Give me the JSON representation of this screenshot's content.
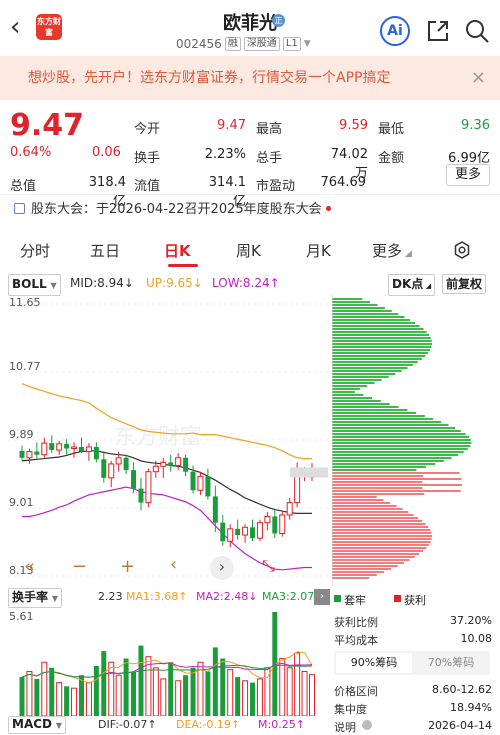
{
  "header": {
    "stock_name": "欧菲光",
    "name_badge": "正",
    "code": "002456",
    "tags": [
      "融",
      "深股通",
      "L1"
    ],
    "logo_text": "东方财富",
    "ai_label": "Ai"
  },
  "ad": {
    "text": "想炒股，先开户！选东方财富证券，行情交易一个APP搞定",
    "close": "×"
  },
  "quote": {
    "price": "9.47",
    "pct": "0.64%",
    "change": "0.06",
    "stats": [
      {
        "label": "今开",
        "value": "9.47",
        "color": "red"
      },
      {
        "label": "最高",
        "value": "9.59",
        "color": "red"
      },
      {
        "label": "最低",
        "value": "9.36",
        "color": "green"
      },
      {
        "label": "换手",
        "value": "2.23%",
        "color": "black"
      },
      {
        "label": "总手",
        "value": "74.02万",
        "color": "black"
      },
      {
        "label": "金额",
        "value": "6.99亿",
        "color": "black"
      },
      {
        "label": "总值",
        "value": "318.4亿",
        "color": "black"
      },
      {
        "label": "流值",
        "value": "314.1亿",
        "color": "black"
      },
      {
        "label": "市盈动",
        "value": "764.69",
        "color": "black"
      }
    ],
    "more": "更多"
  },
  "notice": "股东大会：于2026-04-22召开2025年度股东大会",
  "tabs": [
    "分时",
    "五日",
    "日K",
    "周K",
    "月K",
    "更多"
  ],
  "active_tab": "日K",
  "boll": {
    "label": "BOLL",
    "mid": "MID:8.94↓",
    "up": "UP:9.65↓",
    "low": "LOW:8.24↑",
    "dk": "DK点",
    "fq": "前复权"
  },
  "chart_data": {
    "type": "candlestick",
    "y_labels": [
      "11.65",
      "10.77",
      "9.89",
      "9.01",
      "8.13"
    ],
    "ylim": [
      8.13,
      11.65
    ],
    "watermark": "东方财富",
    "candles": [
      [
        9.75,
        9.82,
        9.62,
        9.66
      ],
      [
        9.66,
        9.78,
        9.58,
        9.74
      ],
      [
        9.74,
        9.86,
        9.65,
        9.7
      ],
      [
        9.7,
        9.92,
        9.66,
        9.85
      ],
      [
        9.85,
        9.95,
        9.72,
        9.76
      ],
      [
        9.76,
        9.88,
        9.7,
        9.84
      ],
      [
        9.84,
        9.9,
        9.7,
        9.78
      ],
      [
        9.78,
        9.86,
        9.66,
        9.8
      ],
      [
        9.8,
        9.92,
        9.72,
        9.74
      ],
      [
        9.74,
        9.85,
        9.62,
        9.8
      ],
      [
        9.8,
        9.86,
        9.6,
        9.64
      ],
      [
        9.64,
        9.72,
        9.34,
        9.4
      ],
      [
        9.4,
        9.62,
        9.28,
        9.58
      ],
      [
        9.58,
        9.74,
        9.48,
        9.66
      ],
      [
        9.66,
        9.7,
        9.45,
        9.5
      ],
      [
        9.5,
        9.6,
        9.2,
        9.26
      ],
      [
        9.26,
        9.4,
        8.98,
        9.08
      ],
      [
        9.08,
        9.52,
        9.02,
        9.48
      ],
      [
        9.48,
        9.62,
        9.4,
        9.55
      ],
      [
        9.55,
        9.66,
        9.4,
        9.6
      ],
      [
        9.6,
        9.7,
        9.48,
        9.56
      ],
      [
        9.56,
        9.72,
        9.5,
        9.66
      ],
      [
        9.66,
        9.7,
        9.42,
        9.48
      ],
      [
        9.48,
        9.56,
        9.2,
        9.24
      ],
      [
        9.24,
        9.48,
        9.18,
        9.42
      ],
      [
        9.42,
        9.52,
        9.12,
        9.16
      ],
      [
        9.16,
        9.3,
        8.7,
        8.82
      ],
      [
        8.82,
        8.92,
        8.52,
        8.58
      ],
      [
        8.58,
        8.8,
        8.5,
        8.74
      ],
      [
        8.74,
        8.86,
        8.6,
        8.66
      ],
      [
        8.66,
        8.8,
        8.56,
        8.76
      ],
      [
        8.76,
        8.86,
        8.58,
        8.62
      ],
      [
        8.62,
        8.86,
        8.58,
        8.82
      ],
      [
        8.82,
        8.96,
        8.72,
        8.9
      ],
      [
        8.9,
        8.98,
        8.62,
        8.68
      ],
      [
        8.68,
        8.96,
        8.64,
        8.92
      ],
      [
        8.92,
        9.14,
        8.86,
        9.08
      ],
      [
        9.08,
        9.6,
        9.02,
        9.42
      ],
      [
        9.42,
        9.54,
        9.36,
        9.48
      ],
      [
        9.41,
        9.59,
        9.36,
        9.47
      ]
    ],
    "mid_line": [
      9.62,
      9.63,
      9.64,
      9.65,
      9.66,
      9.67,
      9.69,
      9.72,
      9.74,
      9.75,
      9.75,
      9.73,
      9.71,
      9.7,
      9.69,
      9.66,
      9.62,
      9.6,
      9.59,
      9.58,
      9.56,
      9.55,
      9.53,
      9.5,
      9.47,
      9.42,
      9.37,
      9.31,
      9.25,
      9.2,
      9.14,
      9.1,
      9.06,
      9.02,
      8.99,
      8.97,
      8.95,
      8.94,
      8.94,
      8.94
    ],
    "up_line": [
      10.62,
      10.58,
      10.55,
      10.52,
      10.49,
      10.46,
      10.44,
      10.42,
      10.4,
      10.37,
      10.3,
      10.24,
      10.18,
      10.14,
      10.1,
      10.06,
      10.02,
      10.0,
      9.99,
      9.98,
      9.97,
      9.97,
      9.97,
      9.98,
      9.96,
      9.96,
      9.96,
      9.94,
      9.92,
      9.9,
      9.88,
      9.86,
      9.84,
      9.82,
      9.79,
      9.75,
      9.7,
      9.66,
      9.65,
      9.65
    ],
    "low_line": [
      8.9,
      8.9,
      8.92,
      8.95,
      8.98,
      9.02,
      9.05,
      9.1,
      9.14,
      9.18,
      9.2,
      9.22,
      9.24,
      9.26,
      9.28,
      9.26,
      9.22,
      9.2,
      9.19,
      9.18,
      9.15,
      9.12,
      9.09,
      9.04,
      8.98,
      8.88,
      8.78,
      8.68,
      8.58,
      8.5,
      8.42,
      8.36,
      8.3,
      8.26,
      8.22,
      8.21,
      8.22,
      8.23,
      8.24,
      8.24
    ]
  },
  "chart_controls": [
    "«",
    "−",
    "+",
    "‹",
    "›",
    "⤡"
  ],
  "chip_legend": {
    "trapped": "套牢",
    "profit": "获利"
  },
  "turnover": {
    "label": "换手率",
    "value": "2.23",
    "ma1": "MA1:3.68↑",
    "ma2": "MA2:2.48↓",
    "ma3": "MA3:2.07",
    "max": "5.61",
    "values": [
      2.1,
      2.4,
      2.0,
      2.9,
      2.6,
      1.8,
      1.6,
      1.5,
      2.2,
      1.8,
      2.7,
      3.5,
      2.9,
      2.2,
      3.1,
      2.4,
      3.8,
      3.2,
      2.6,
      2.0,
      2.9,
      1.9,
      2.2,
      2.6,
      2.9,
      2.4,
      3.7,
      3.1,
      2.5,
      2.1,
      1.9,
      1.8,
      2.0,
      2.6,
      5.61,
      3.1,
      2.6,
      3.4,
      2.4,
      2.23
    ]
  },
  "macd": {
    "label": "MACD",
    "dif": "DIF:-0.07↑",
    "dea": "DEA:-0.19↑",
    "m": "M:0.25↑"
  },
  "chip_stats": {
    "rows": [
      {
        "label": "获利比例",
        "value": "37.20%"
      },
      {
        "label": "平均成本",
        "value": "10.08"
      }
    ],
    "tab_90": "90%筹码",
    "tab_70": "70%筹码",
    "rows2": [
      {
        "label": "价格区间",
        "value": "8.60-12.62"
      },
      {
        "label": "集中度",
        "value": "18.94%"
      },
      {
        "label": "说明",
        "value": "2026-04-14"
      }
    ]
  },
  "colors": {
    "red": "#e2212a",
    "green": "#1a9c3b",
    "orange": "#f0a020",
    "purple": "#c020c0",
    "dark": "#333333"
  }
}
